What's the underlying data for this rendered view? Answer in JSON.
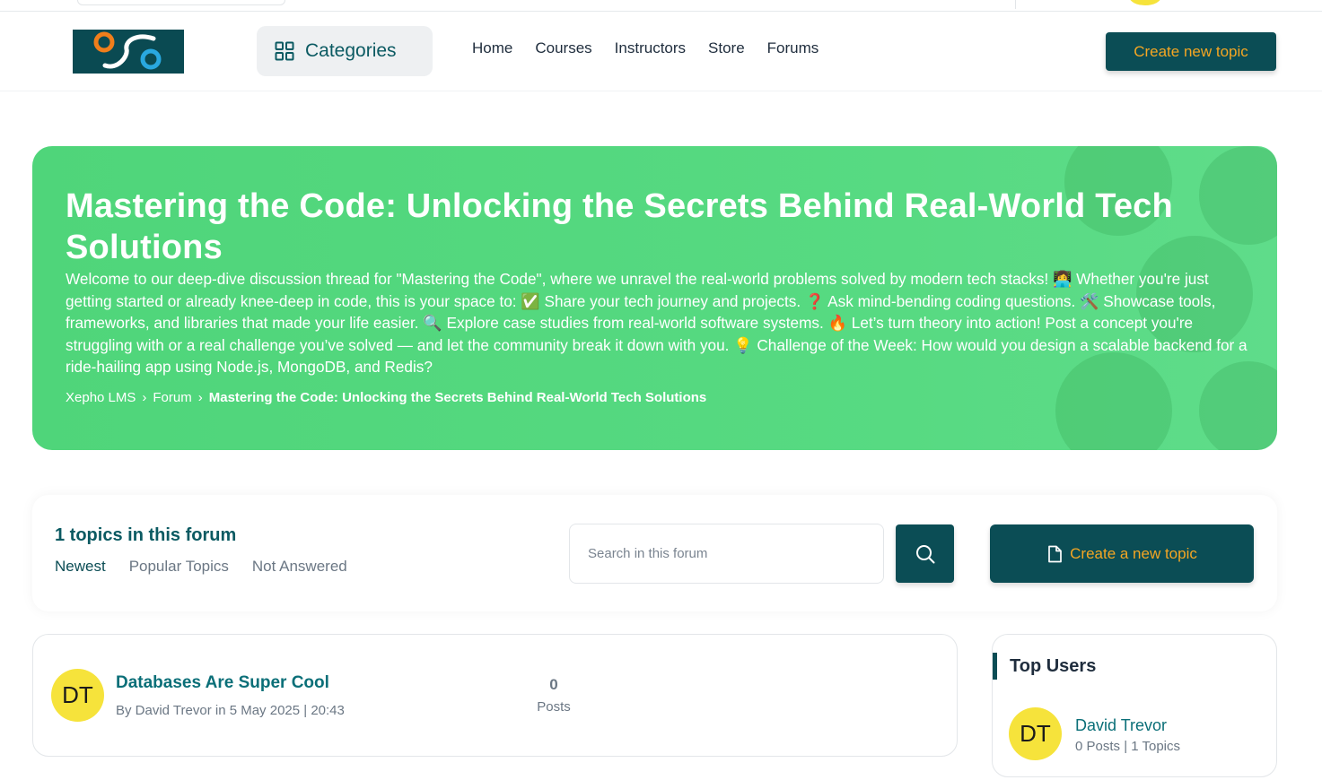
{
  "nav": {
    "categories_label": "Categories",
    "links": [
      "Home",
      "Courses",
      "Instructors",
      "Store",
      "Forums"
    ],
    "create_topic_label": "Create new topic"
  },
  "hero": {
    "title": "Mastering the Code: Unlocking the Secrets Behind Real-World Tech Solutions",
    "description": "Welcome to our deep-dive discussion thread for \"Mastering the Code\", where we unravel the real-world problems solved by modern tech stacks! 👩‍💻 Whether you're just getting started or already knee-deep in code, this is your space to: ✅ Share your tech journey and projects. ❓ Ask mind-bending coding questions. 🛠️ Showcase tools, frameworks, and libraries that made your life easier. 🔍 Explore case studies from real-world software systems. 🔥 Let’s turn theory into action! Post a concept you're struggling with or a real challenge you’ve solved — and let the community break it down with you. 💡 Challenge of the Week: How would you design a scalable backend for a ride-hailing app using Node.js, MongoDB, and Redis?",
    "breadcrumb": [
      "Xepho LMS",
      "Forum",
      "Mastering the Code: Unlocking the Secrets Behind Real-World Tech Solutions"
    ]
  },
  "forum": {
    "topics_count": "1 topics in this forum",
    "tabs": [
      "Newest",
      "Popular Topics",
      "Not Answered"
    ],
    "search_placeholder": "Search in this forum",
    "create_new_label": "Create a new topic"
  },
  "topics": [
    {
      "avatar_initials": "DT",
      "title": "Databases Are Super Cool",
      "meta": "By David Trevor in 5 May 2025 | 20:43",
      "posts_count": "0",
      "posts_label": "Posts"
    }
  ],
  "top_users": {
    "title": "Top Users",
    "users": [
      {
        "avatar_initials": "DT",
        "name": "David Trevor",
        "stats": "0 Posts | 1 Topics"
      }
    ]
  },
  "colors": {
    "brand_dark": "#0b4d55",
    "accent_orange": "#f5a623",
    "hero_green": "#55d880",
    "avatar_yellow": "#f6e33b"
  },
  "icons": {
    "categories": "grid-icon",
    "search": "search-icon",
    "create": "file-icon"
  }
}
